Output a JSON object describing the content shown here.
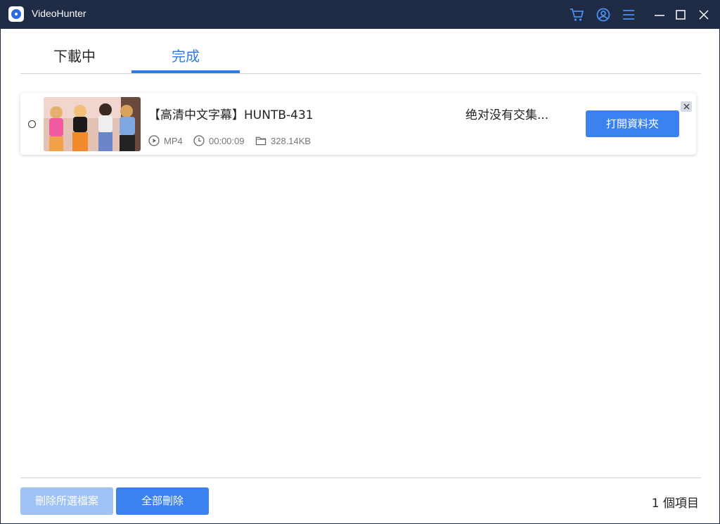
{
  "app": {
    "title": "VideoHunter"
  },
  "titlebar": {
    "icons": [
      "cart-icon",
      "account-icon",
      "menu-icon",
      "minimize-icon",
      "maximize-icon",
      "close-icon"
    ],
    "accent": "#4a90f0"
  },
  "tabs": [
    {
      "label": "下載中",
      "active": false
    },
    {
      "label": "完成",
      "active": true
    }
  ],
  "items": [
    {
      "title": "【高清中文字幕】HUNTB-431",
      "subtitle": "绝对没有交集...",
      "format": "MP4",
      "duration": "00:00:09",
      "size": "328.14KB",
      "open_label": "打開資料夾"
    }
  ],
  "footer": {
    "delete_selected_label": "刪除所選檔案",
    "delete_all_label": "全部刪除",
    "count_label": "1 個項目"
  },
  "colors": {
    "primary": "#3b82f0",
    "disabled": "#9fc2f5",
    "titlebar": "#1f2a44"
  }
}
